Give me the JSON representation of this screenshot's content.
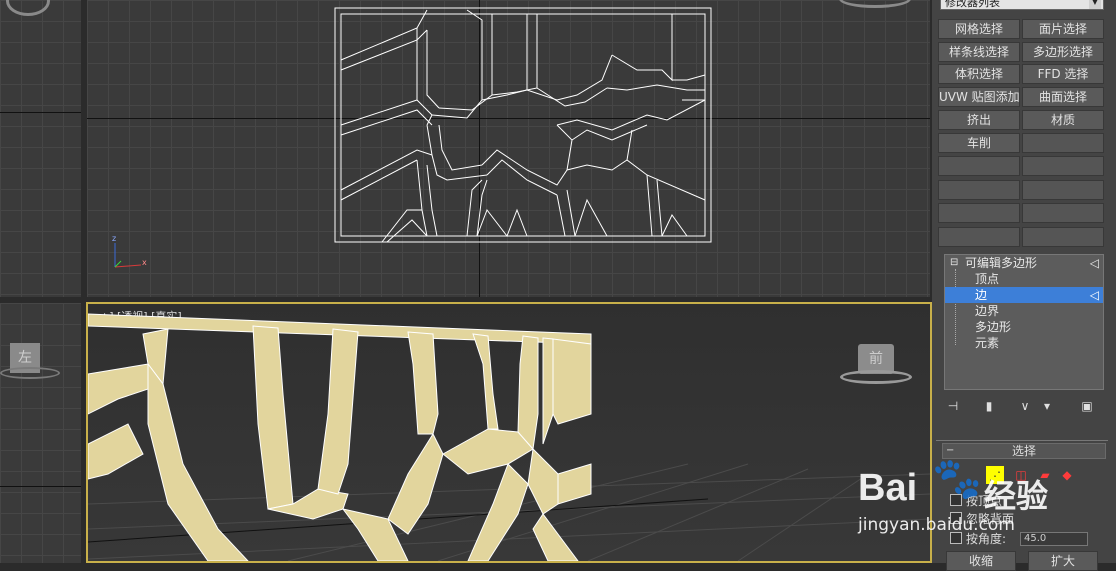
{
  "modifier_list": {
    "label": "修改器列表"
  },
  "buttons": [
    {
      "label": "网格选择"
    },
    {
      "label": "面片选择"
    },
    {
      "label": "样条线选择"
    },
    {
      "label": "多边形选择"
    },
    {
      "label": "体积选择"
    },
    {
      "label": "FFD 选择"
    },
    {
      "label": "UVW 贴图添加"
    },
    {
      "label": "曲面选择"
    },
    {
      "label": "挤出"
    },
    {
      "label": "材质"
    },
    {
      "label": "车削"
    },
    {
      "label": ""
    },
    {
      "label": ""
    },
    {
      "label": ""
    },
    {
      "label": ""
    },
    {
      "label": ""
    },
    {
      "label": ""
    },
    {
      "label": ""
    },
    {
      "label": ""
    },
    {
      "label": ""
    }
  ],
  "stack": {
    "root": "可编辑多边形",
    "expand_symbol": "⊟",
    "items": [
      {
        "label": "顶点",
        "selected": false
      },
      {
        "label": "边",
        "selected": true
      },
      {
        "label": "边界",
        "selected": false
      },
      {
        "label": "多边形",
        "selected": false
      },
      {
        "label": "元素",
        "selected": false
      }
    ]
  },
  "selection": {
    "title": "选择",
    "by_vertex": "按顶点",
    "ignore_backfacing": "忽略背面",
    "by_angle": "按角度:",
    "angle_value": "45.0",
    "shrink": "收缩",
    "grow": "扩大"
  },
  "viewports": {
    "left_label": "左",
    "persp_label": "+] [透视] [真实]",
    "cube_label": "前"
  },
  "axis": {
    "z": "z",
    "x": "x"
  },
  "watermark": {
    "brand": "Bai",
    "brand_cn": "经验",
    "url": "jingyan.baidu.com"
  },
  "icons": [
    "pin-icon",
    "show-end-result-icon",
    "make-unique-icon",
    "remove-modifier-icon",
    "configure-modifier-sets-icon"
  ],
  "colors": {
    "selection_blue": "#3d7fd8",
    "model_fill": "#e2d59d",
    "viewport_border": "#c8b04a",
    "wireframe": "#ffffff"
  }
}
